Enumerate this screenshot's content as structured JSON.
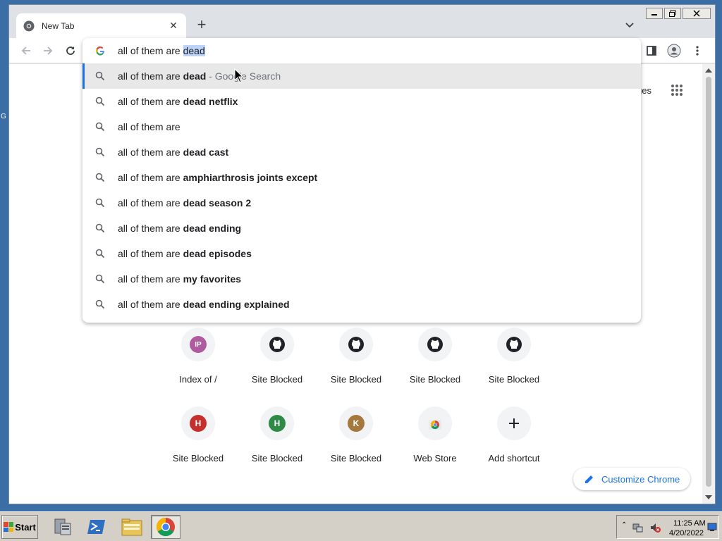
{
  "desktop": {
    "edge_letter": "G"
  },
  "browser": {
    "tab": {
      "title": "New Tab"
    },
    "omnibox": {
      "typed": "all of them are ",
      "selected": "dead",
      "suggestions": [
        {
          "prefix": "all of them are ",
          "bold": "dead",
          "hint": " - Google Search",
          "active": true
        },
        {
          "prefix": "all of them are ",
          "bold": "dead netflix",
          "hint": ""
        },
        {
          "prefix": "all of them are",
          "bold": "",
          "hint": ""
        },
        {
          "prefix": "all of them are ",
          "bold": "dead cast",
          "hint": ""
        },
        {
          "prefix": "all of them are ",
          "bold": "amphiarthrosis joints except",
          "hint": ""
        },
        {
          "prefix": "all of them are ",
          "bold": "dead season 2",
          "hint": ""
        },
        {
          "prefix": "all of them are ",
          "bold": "dead ending",
          "hint": ""
        },
        {
          "prefix": "all of them are ",
          "bold": "dead episodes",
          "hint": ""
        },
        {
          "prefix": "all of them are ",
          "bold": "my favorites",
          "hint": ""
        },
        {
          "prefix": "all of them are ",
          "bold": "dead ending explained",
          "hint": ""
        }
      ]
    },
    "ntp": {
      "images_link": "ges",
      "shortcuts_row1": [
        {
          "label": "Index of /",
          "icon": "letter",
          "letter": "IP",
          "color": "#b05aa0"
        },
        {
          "label": "Site Blocked",
          "icon": "github-icon"
        },
        {
          "label": "Site Blocked",
          "icon": "github-icon"
        },
        {
          "label": "Site Blocked",
          "icon": "github-icon"
        },
        {
          "label": "Site Blocked",
          "icon": "github-icon"
        }
      ],
      "shortcuts_row2": [
        {
          "label": "Site Blocked",
          "icon": "letter",
          "letter": "H",
          "color": "#c5302c"
        },
        {
          "label": "Site Blocked",
          "icon": "letter",
          "letter": "H",
          "color": "#2f8a47"
        },
        {
          "label": "Site Blocked",
          "icon": "letter",
          "letter": "K",
          "color": "#a6783d"
        },
        {
          "label": "Web Store",
          "icon": "chrome-web-store-icon"
        },
        {
          "label": "Add shortcut",
          "icon": "plus-icon"
        }
      ],
      "customize_label": "Customize Chrome"
    }
  },
  "taskbar": {
    "start_label": "Start",
    "clock_time": "11:25 AM",
    "clock_date": "4/20/2022"
  },
  "colors": {
    "accent": "#1a73e8",
    "taskbar": "#d4d0c8",
    "desktop": "#3a6ea5"
  }
}
